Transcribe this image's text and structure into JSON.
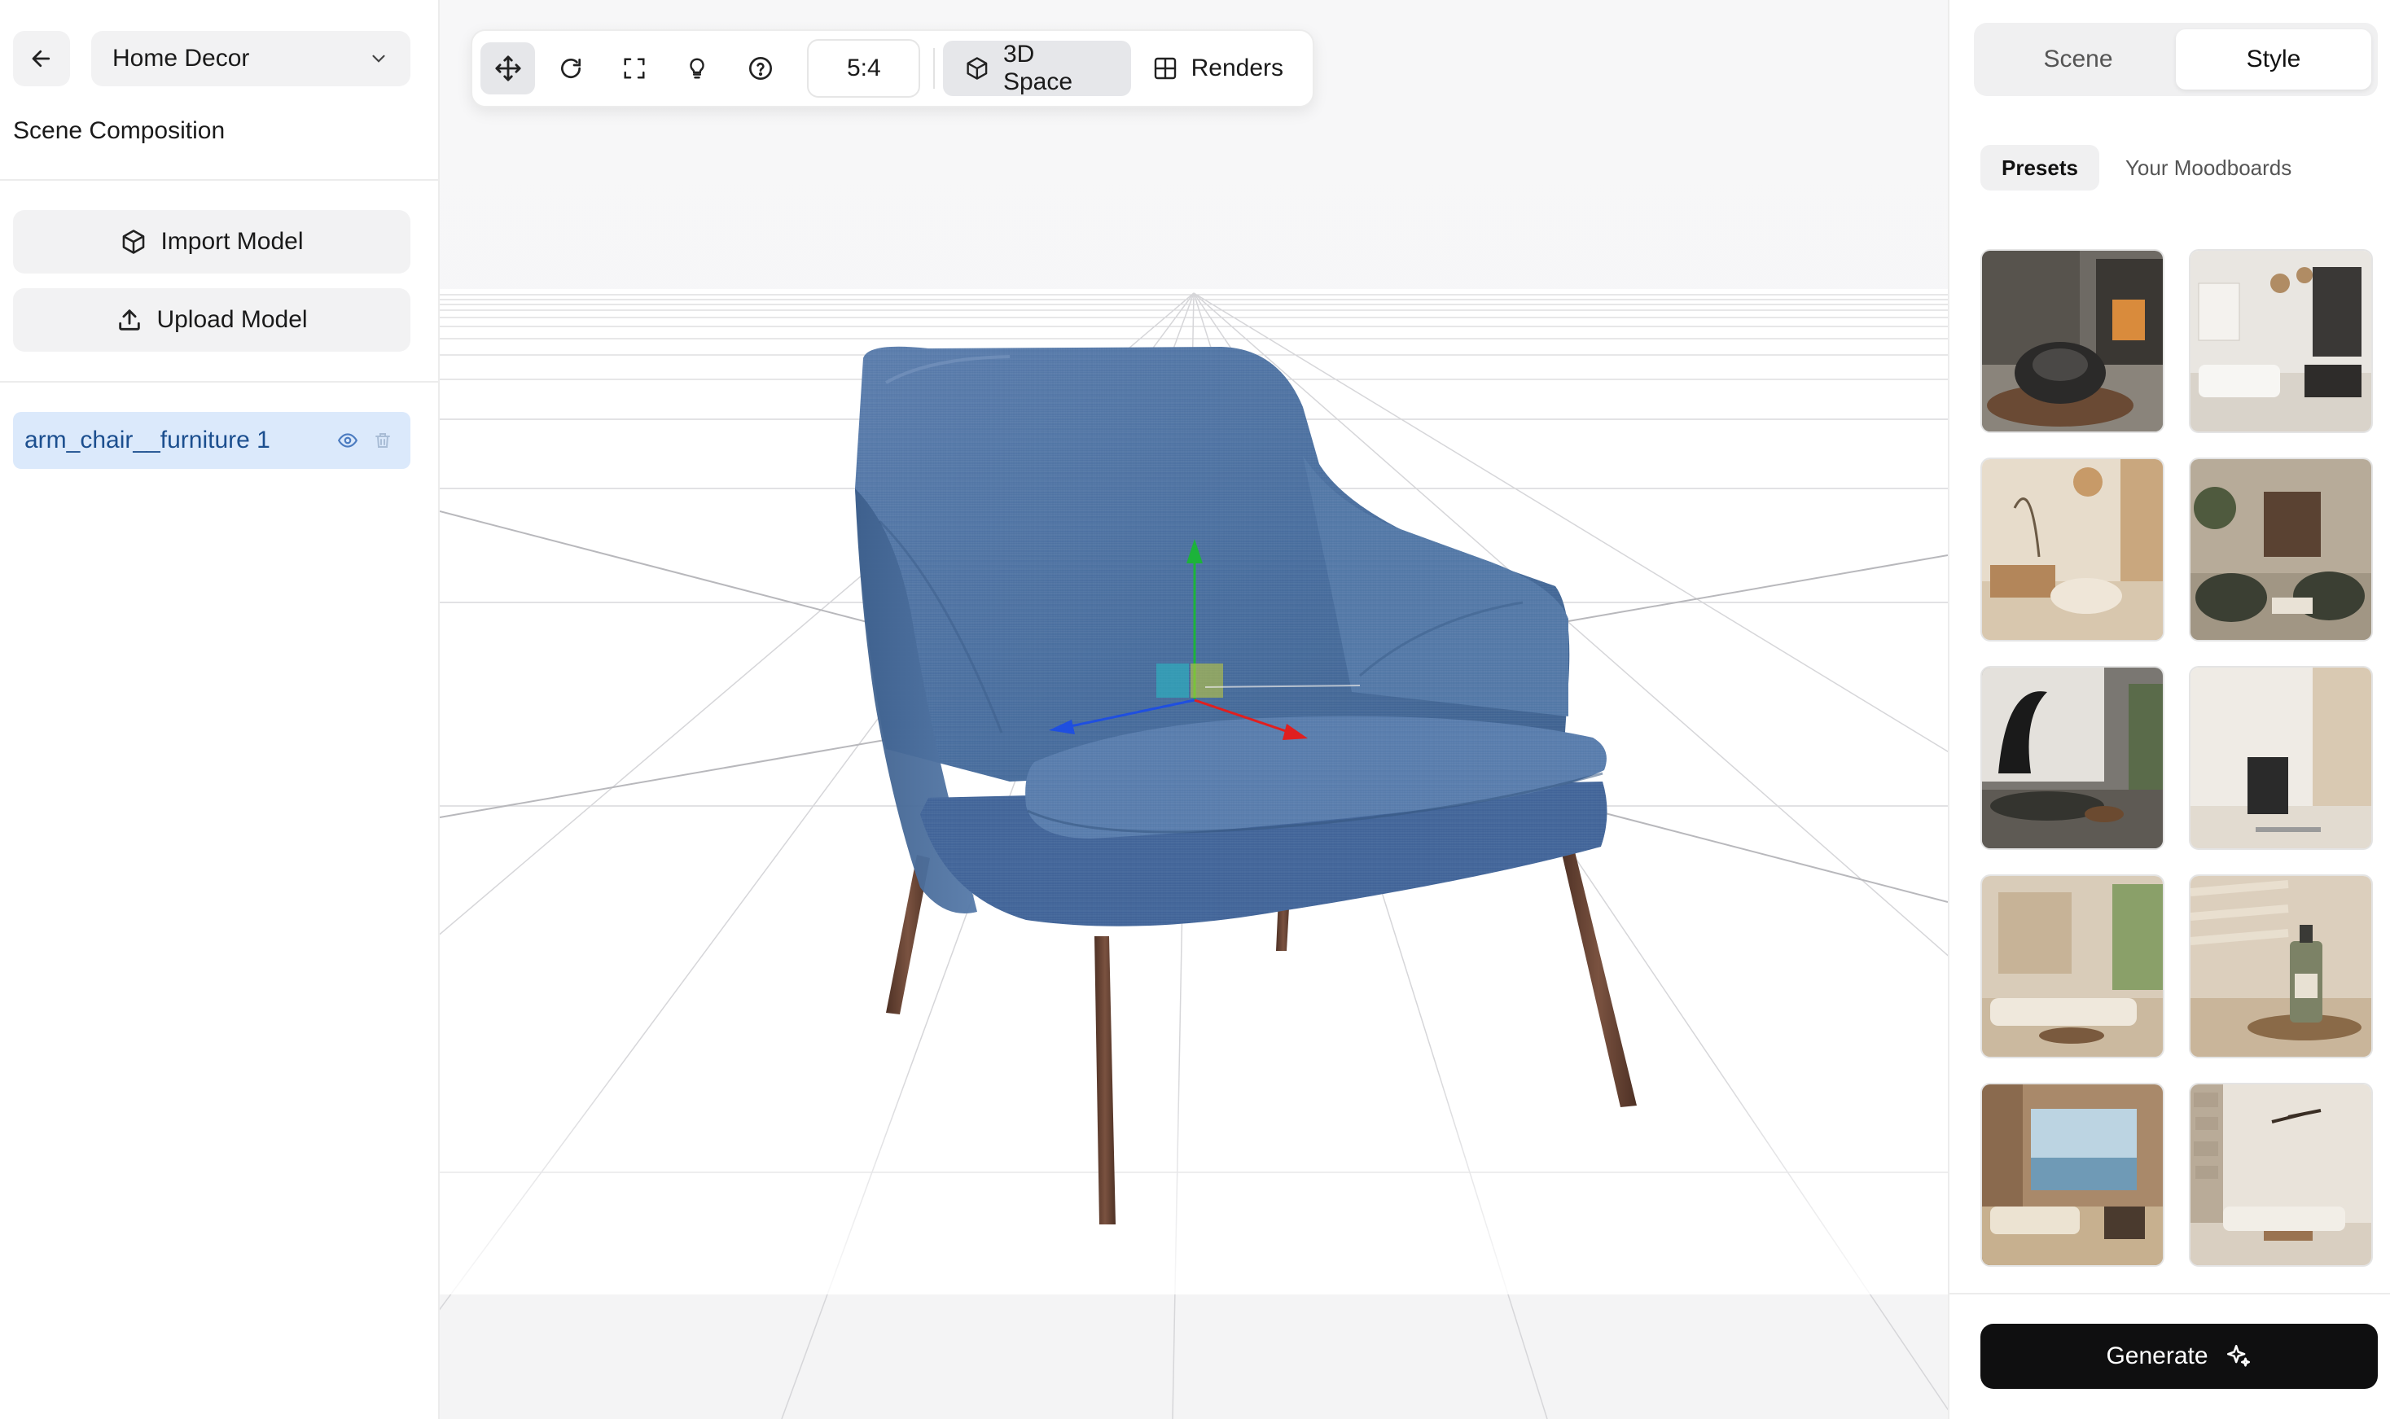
{
  "sidebar": {
    "project": "Home Decor",
    "section_title": "Scene Composition",
    "import_label": "Import Model",
    "upload_label": "Upload Model",
    "layers": [
      {
        "name": "arm_chair__furniture 1"
      }
    ]
  },
  "toolbar": {
    "aspect_ratio": "5:4",
    "views": [
      {
        "label": "3D Space",
        "active": true
      },
      {
        "label": "Renders",
        "active": false
      }
    ]
  },
  "right_panel": {
    "tabs": [
      {
        "label": "Scene",
        "active": false
      },
      {
        "label": "Style",
        "active": true
      }
    ],
    "subtabs": [
      {
        "label": "Presets",
        "active": true
      },
      {
        "label": "Your Moodboards",
        "active": false
      }
    ],
    "generate_label": "Generate"
  },
  "colors": {
    "accent_blue": "#1c4f8f",
    "layer_highlight": "#dbe9fb",
    "chair_fabric": "#4f74a3",
    "chair_legs": "#6a4634",
    "generate_bg": "#0f0f10"
  },
  "icons": [
    "arrow-left-icon",
    "chevron-down-icon",
    "cube-icon",
    "upload-icon",
    "eye-icon",
    "trash-icon",
    "move-icon",
    "rotate-icon",
    "scale-icon",
    "light-bulb-icon",
    "help-icon",
    "grid-icon",
    "sparkle-icon"
  ]
}
